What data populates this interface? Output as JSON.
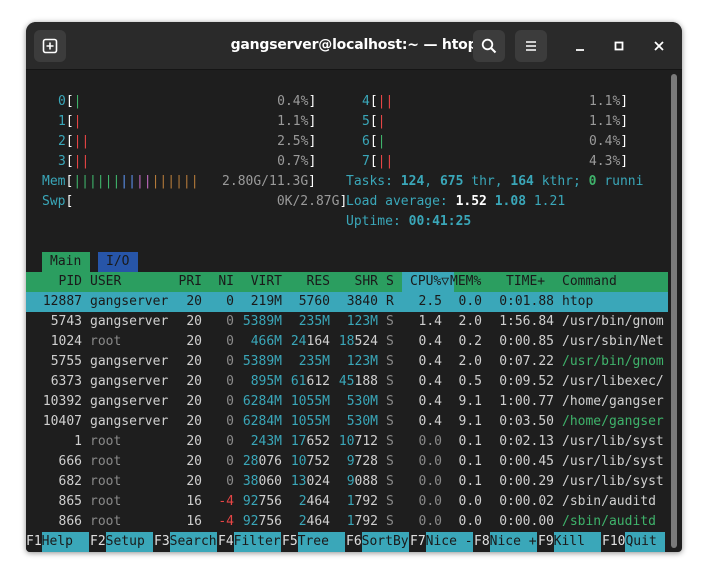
{
  "window": {
    "title": "gangserver@localhost:~ — htop"
  },
  "cpu_meters": [
    {
      "id": "0",
      "bars": "|",
      "value": "0.4%"
    },
    {
      "id": "1",
      "bars": "|",
      "value": "1.1%"
    },
    {
      "id": "2",
      "bars": "||",
      "value": "2.5%"
    },
    {
      "id": "3",
      "bars": "||",
      "value": "0.7%"
    },
    {
      "id": "4",
      "bars": "||",
      "value": "1.1%"
    },
    {
      "id": "5",
      "bars": "|",
      "value": "1.1%"
    },
    {
      "id": "6",
      "bars": "|",
      "value": "0.4%"
    },
    {
      "id": "7",
      "bars": "||",
      "value": "4.3%"
    }
  ],
  "mem": {
    "label": "Mem",
    "value": "2.80G/11.3G"
  },
  "swp": {
    "label": "Swp",
    "value": "0K/2.87G"
  },
  "tasks": {
    "label": "Tasks: ",
    "count": "124",
    "thr": "675",
    "thr_label": " thr, ",
    "kthr": "164",
    "kthr_label": " kthr; ",
    "running": "0",
    "running_label": " runni"
  },
  "load": {
    "label": "Load average: ",
    "v1": "1.52",
    "v5": "1.08",
    "v15": "1.21"
  },
  "uptime": {
    "label": "Uptime: ",
    "value": "00:41:25"
  },
  "tabs": {
    "main": "Main",
    "io": "I/O"
  },
  "columns": {
    "pid": "PID",
    "user": "USER",
    "pri": "PRI",
    "ni": "NI",
    "virt": "VIRT",
    "res": "RES",
    "shr": "SHR",
    "s": "S",
    "cpu": "CPU%▽",
    "mem": "MEM%",
    "time": "TIME+",
    "command": "Command"
  },
  "processes": [
    {
      "pid": "12887",
      "user": "gangserver",
      "pri": "20",
      "ni": "0",
      "virt": "219M",
      "res": "5760",
      "shr": "3840",
      "s": "R",
      "cpu": "2.5",
      "mem": "0.0",
      "time": "0:01.88",
      "command": "htop"
    },
    {
      "pid": "5743",
      "user": "gangserver",
      "pri": "20",
      "ni": "0",
      "virt": "5389M",
      "res": "235M",
      "shr": "123M",
      "s": "S",
      "cpu": "1.4",
      "mem": "2.0",
      "time": "1:56.84",
      "command": "/usr/bin/gnom"
    },
    {
      "pid": "1024",
      "user": "root",
      "pri": "20",
      "ni": "0",
      "virt": "466M",
      "res": "24164",
      "shr": "18524",
      "s": "S",
      "cpu": "0.4",
      "mem": "0.2",
      "time": "0:00.85",
      "command": "/usr/sbin/Net"
    },
    {
      "pid": "5755",
      "user": "gangserver",
      "pri": "20",
      "ni": "0",
      "virt": "5389M",
      "res": "235M",
      "shr": "123M",
      "s": "S",
      "cpu": "0.4",
      "mem": "2.0",
      "time": "0:07.22",
      "command": "/usr/bin/gnom"
    },
    {
      "pid": "6373",
      "user": "gangserver",
      "pri": "20",
      "ni": "0",
      "virt": "895M",
      "res": "61612",
      "shr": "45188",
      "s": "S",
      "cpu": "0.4",
      "mem": "0.5",
      "time": "0:09.52",
      "command": "/usr/libexec/"
    },
    {
      "pid": "10392",
      "user": "gangserver",
      "pri": "20",
      "ni": "0",
      "virt": "6284M",
      "res": "1055M",
      "shr": "530M",
      "s": "S",
      "cpu": "0.4",
      "mem": "9.1",
      "time": "1:00.77",
      "command": "/home/gangser"
    },
    {
      "pid": "10407",
      "user": "gangserver",
      "pri": "20",
      "ni": "0",
      "virt": "6284M",
      "res": "1055M",
      "shr": "530M",
      "s": "S",
      "cpu": "0.4",
      "mem": "9.1",
      "time": "0:03.50",
      "command": "/home/gangser"
    },
    {
      "pid": "1",
      "user": "root",
      "pri": "20",
      "ni": "0",
      "virt": "243M",
      "res": "17652",
      "shr": "10712",
      "s": "S",
      "cpu": "0.0",
      "mem": "0.1",
      "time": "0:02.13",
      "command": "/usr/lib/syst"
    },
    {
      "pid": "666",
      "user": "root",
      "pri": "20",
      "ni": "0",
      "virt": "28076",
      "res": "10752",
      "shr": "9728",
      "s": "S",
      "cpu": "0.0",
      "mem": "0.1",
      "time": "0:00.45",
      "command": "/usr/lib/syst"
    },
    {
      "pid": "682",
      "user": "root",
      "pri": "20",
      "ni": "0",
      "virt": "38060",
      "res": "13024",
      "shr": "9088",
      "s": "S",
      "cpu": "0.0",
      "mem": "0.1",
      "time": "0:00.29",
      "command": "/usr/lib/syst"
    },
    {
      "pid": "865",
      "user": "root",
      "pri": "16",
      "ni": "-4",
      "virt": "92756",
      "res": "2464",
      "shr": "1792",
      "s": "S",
      "cpu": "0.0",
      "mem": "0.0",
      "time": "0:00.02",
      "command": "/sbin/auditd"
    },
    {
      "pid": "866",
      "user": "root",
      "pri": "16",
      "ni": "-4",
      "virt": "92756",
      "res": "2464",
      "shr": "1792",
      "s": "S",
      "cpu": "0.0",
      "mem": "0.0",
      "time": "0:00.00",
      "command": "/sbin/auditd"
    }
  ],
  "fkeys": [
    {
      "key": "F1",
      "label": "Help  "
    },
    {
      "key": "F2",
      "label": "Setup "
    },
    {
      "key": "F3",
      "label": "Search"
    },
    {
      "key": "F4",
      "label": "Filter"
    },
    {
      "key": "F5",
      "label": "Tree  "
    },
    {
      "key": "F6",
      "label": "SortBy"
    },
    {
      "key": "F7",
      "label": "Nice -"
    },
    {
      "key": "F8",
      "label": "Nice +"
    },
    {
      "key": "F9",
      "label": "Kill  "
    },
    {
      "key": "F10",
      "label": "Quit "
    }
  ],
  "colors": {
    "cyan": "#3aa7b9",
    "green": "#2b9e60",
    "blue": "#2755a8",
    "red": "#e64545",
    "terminal_bg": "#1e1e1e"
  },
  "icons": {
    "new_tab": "new-tab-icon",
    "search": "search-icon",
    "menu": "hamburger-menu-icon",
    "minimize": "minimize-icon",
    "maximize": "maximize-icon",
    "close": "close-icon"
  }
}
